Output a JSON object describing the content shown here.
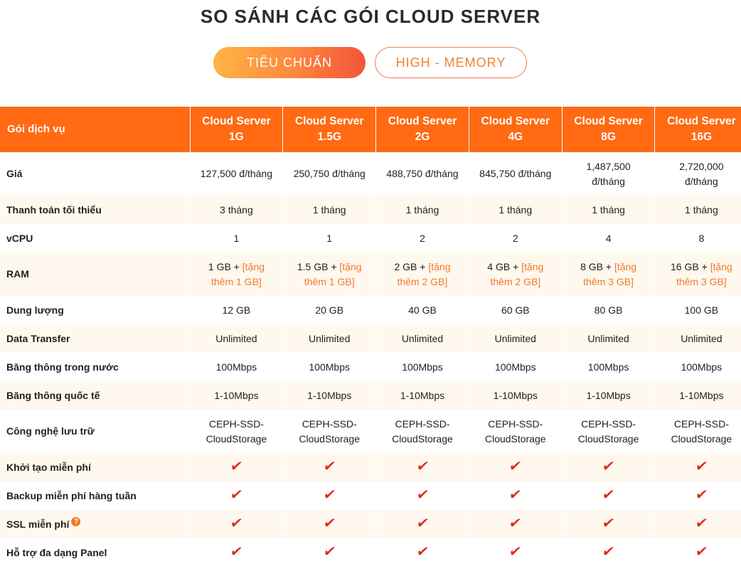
{
  "page": {
    "title": "SO SÁNH CÁC GÓI CLOUD SERVER"
  },
  "tabs": [
    {
      "label": "TIÊU CHUẨN",
      "active": true
    },
    {
      "label": "HIGH - MEMORY",
      "active": false
    }
  ],
  "colors": {
    "header_bg": "#ff6a13",
    "accent": "#f07a2a",
    "check": "#e02a1a",
    "row_alt": "#fff8ee"
  },
  "table": {
    "header": {
      "label": "Gói dịch vụ",
      "plans": [
        {
          "line1": "Cloud Server",
          "line2": "1G"
        },
        {
          "line1": "Cloud Server",
          "line2": "1.5G"
        },
        {
          "line1": "Cloud Server",
          "line2": "2G"
        },
        {
          "line1": "Cloud Server",
          "line2": "4G"
        },
        {
          "line1": "Cloud Server",
          "line2": "8G"
        },
        {
          "line1": "Cloud Server",
          "line2": "16G"
        }
      ]
    },
    "rows": {
      "price": {
        "label": "Giá",
        "values": [
          {
            "a": "127,500 đ/tháng",
            "b": ""
          },
          {
            "a": "250,750 đ/tháng",
            "b": ""
          },
          {
            "a": "488,750 đ/tháng",
            "b": ""
          },
          {
            "a": "845,750 đ/tháng",
            "b": ""
          },
          {
            "a": "1,487,500",
            "b": "đ/tháng"
          },
          {
            "a": "2,720,000",
            "b": "đ/tháng"
          }
        ]
      },
      "min_payment": {
        "label": "Thanh toán tối thiểu",
        "values": [
          "3 tháng",
          "1 tháng",
          "1 tháng",
          "1 tháng",
          "1 tháng",
          "1 tháng"
        ]
      },
      "vcpu": {
        "label": "vCPU",
        "values": [
          "1",
          "1",
          "2",
          "2",
          "4",
          "8"
        ]
      },
      "ram": {
        "label": "RAM",
        "values": [
          {
            "base": "1 GB + ",
            "bonus1": "[tặng",
            "bonus2": "thêm 1 GB]"
          },
          {
            "base": "1.5 GB + ",
            "bonus1": "[tặng",
            "bonus2": "thêm 1 GB]"
          },
          {
            "base": "2 GB + ",
            "bonus1": "[tặng",
            "bonus2": "thêm 2 GB]"
          },
          {
            "base": "4 GB + ",
            "bonus1": "[tặng",
            "bonus2": "thêm 2 GB]"
          },
          {
            "base": "8 GB + ",
            "bonus1": "[tặng",
            "bonus2": "thêm 3 GB]"
          },
          {
            "base": "16 GB + ",
            "bonus1": "[tặng",
            "bonus2": "thêm 3 GB]"
          }
        ]
      },
      "storage": {
        "label": "Dung lượng",
        "values": [
          "12 GB",
          "20 GB",
          "40 GB",
          "60 GB",
          "80 GB",
          "100 GB"
        ]
      },
      "data_transfer": {
        "label": "Data Transfer",
        "values": [
          "Unlimited",
          "Unlimited",
          "Unlimited",
          "Unlimited",
          "Unlimited",
          "Unlimited"
        ]
      },
      "domestic_bw": {
        "label": "Băng thông trong nước",
        "values": [
          "100Mbps",
          "100Mbps",
          "100Mbps",
          "100Mbps",
          "100Mbps",
          "100Mbps"
        ]
      },
      "intl_bw": {
        "label": "Băng thông quốc tế",
        "values": [
          "1-10Mbps",
          "1-10Mbps",
          "1-10Mbps",
          "1-10Mbps",
          "1-10Mbps",
          "1-10Mbps"
        ]
      },
      "storage_tech": {
        "label": "Công nghệ lưu trữ",
        "values": [
          {
            "a": "CEPH-SSD-",
            "b": "CloudStorage"
          },
          {
            "a": "CEPH-SSD-",
            "b": "CloudStorage"
          },
          {
            "a": "CEPH-SSD-",
            "b": "CloudStorage"
          },
          {
            "a": "CEPH-SSD-",
            "b": "CloudStorage"
          },
          {
            "a": "CEPH-SSD-",
            "b": "CloudStorage"
          },
          {
            "a": "CEPH-SSD-",
            "b": "CloudStorage"
          }
        ]
      },
      "free_setup": {
        "label": "Khởi tạo miễn phí",
        "values": [
          true,
          true,
          true,
          true,
          true,
          true
        ]
      },
      "weekly_backup": {
        "label": "Backup miễn phí hàng tuần",
        "values": [
          true,
          true,
          true,
          true,
          true,
          true
        ]
      },
      "free_ssl": {
        "label": "SSL miễn phí",
        "help_icon": "question-icon",
        "values": [
          true,
          true,
          true,
          true,
          true,
          true
        ]
      },
      "panel_support": {
        "label": "Hỗ trợ đa dạng Panel",
        "values": [
          true,
          true,
          true,
          true,
          true,
          true
        ]
      }
    },
    "check_glyph": "✔"
  }
}
